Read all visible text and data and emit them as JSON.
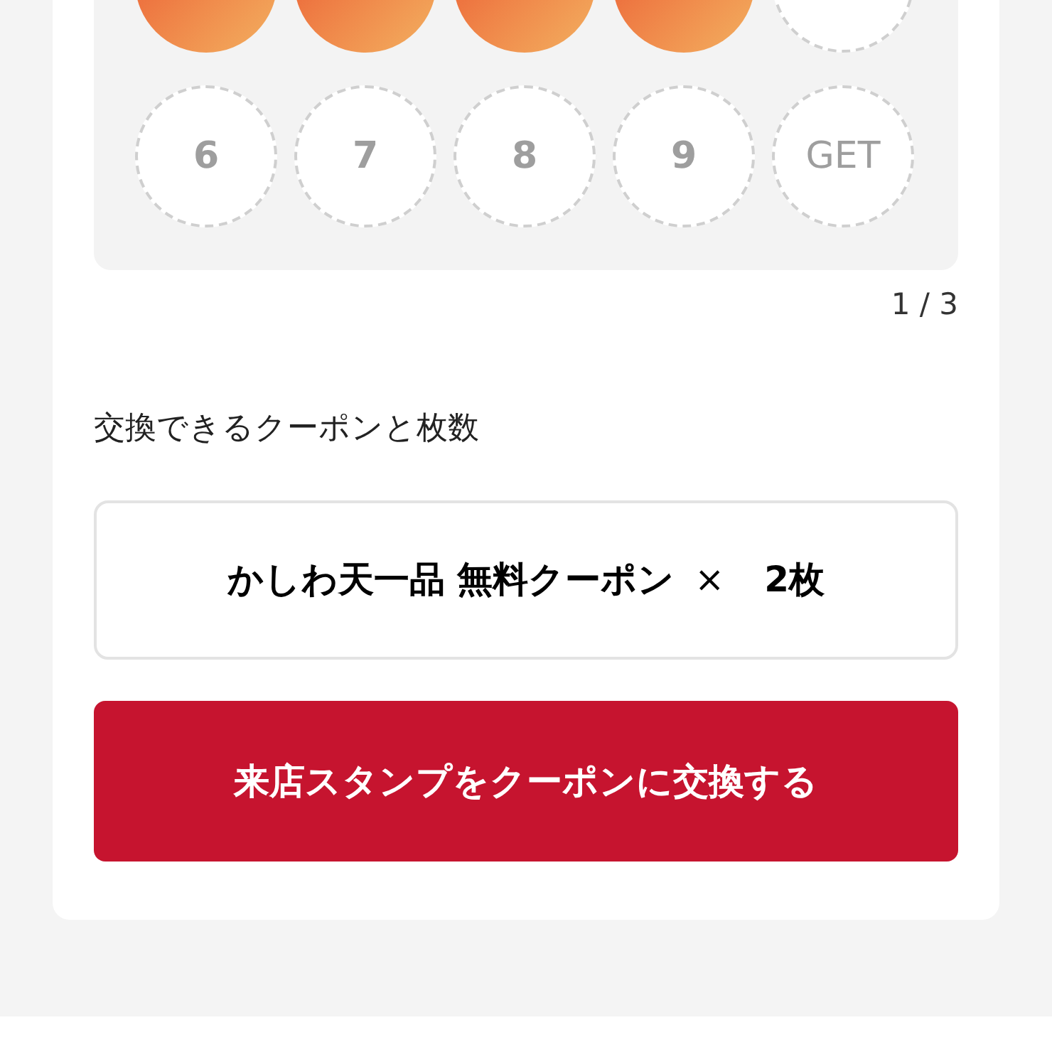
{
  "stamp_card": {
    "stamps": [
      {
        "kind": "stamped"
      },
      {
        "kind": "stamped"
      },
      {
        "kind": "stamped"
      },
      {
        "kind": "stamped"
      },
      {
        "kind": "empty"
      },
      {
        "kind": "number",
        "label": "6"
      },
      {
        "kind": "number",
        "label": "7"
      },
      {
        "kind": "number",
        "label": "8"
      },
      {
        "kind": "number",
        "label": "9"
      },
      {
        "kind": "goal",
        "label": "GET"
      }
    ],
    "page": "1 / 3"
  },
  "exchange": {
    "heading": "交換できるクーポンと枚数",
    "coupon": {
      "name": "かしわ天一品 無料クーポン",
      "times": "×",
      "count": "2枚"
    },
    "button": "来店スタンプをクーポンに交換する"
  }
}
